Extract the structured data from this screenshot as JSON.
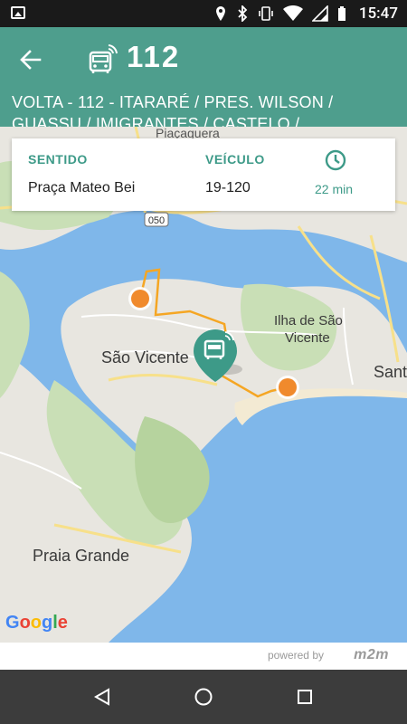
{
  "status_bar": {
    "time": "15:47",
    "icons": [
      "gallery-icon",
      "location-icon",
      "bluetooth-icon",
      "vibrate-icon",
      "wifi-icon",
      "signal-icon",
      "battery-icon"
    ]
  },
  "app_bar": {
    "back_icon": "arrow-back-icon",
    "bus_icon": "bus-realtime-icon",
    "route_number": "112",
    "accent": "#4e9e8d"
  },
  "route": {
    "description": "VOLTA - 112 - ITARARÉ / PRES. WILSON / GUASSU / IMIGRANTES / CASTELO /"
  },
  "info_card": {
    "direction_header": "SENTIDO",
    "direction_value": "Praça Mateo Bei",
    "vehicle_header": "VEÍCULO",
    "vehicle_value": "19-120",
    "eta_icon": "clock-icon",
    "eta_value": "22 min",
    "accent": "#3d9a88"
  },
  "map": {
    "labels": {
      "piacaguera": "Piaçaguera",
      "sao_vicente": "São Vicente",
      "ilha_line1": "Ilha de São",
      "ilha_line2": "Vicente",
      "santos": "Sant",
      "praia_grande": "Praia Grande",
      "highway": "050"
    },
    "google_logo": "Google",
    "route_color": "#f5a623",
    "stop_color": "#f08a2c",
    "bus_marker_color": "#3d9a88"
  },
  "footer": {
    "powered_by": "powered by",
    "brand": "m2m"
  },
  "nav_bar": {
    "back_icon": "nav-back-icon",
    "home_icon": "nav-home-icon",
    "recents_icon": "nav-recents-icon"
  }
}
